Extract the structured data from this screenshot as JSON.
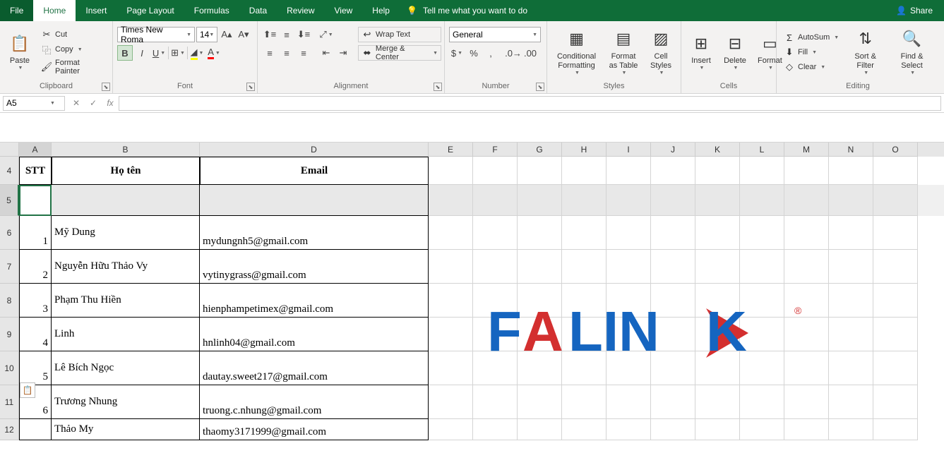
{
  "tabs": {
    "file": "File",
    "home": "Home",
    "insert": "Insert",
    "pageLayout": "Page Layout",
    "formulas": "Formulas",
    "data": "Data",
    "review": "Review",
    "view": "View",
    "help": "Help",
    "tellme": "Tell me what you want to do",
    "share": "Share"
  },
  "ribbon": {
    "clipboard": {
      "label": "Clipboard",
      "paste": "Paste",
      "cut": "Cut",
      "copy": "Copy",
      "formatPainter": "Format Painter"
    },
    "font": {
      "label": "Font",
      "name": "Times New Roma",
      "size": "14"
    },
    "alignment": {
      "label": "Alignment",
      "wrapText": "Wrap Text",
      "mergeCenter": "Merge & Center"
    },
    "number": {
      "label": "Number",
      "format": "General"
    },
    "styles": {
      "label": "Styles",
      "conditional": "Conditional Formatting",
      "formatTable": "Format as Table",
      "cellStyles": "Cell Styles"
    },
    "cells": {
      "label": "Cells",
      "insert": "Insert",
      "delete": "Delete",
      "format": "Format"
    },
    "editing": {
      "label": "Editing",
      "autosum": "AutoSum",
      "fill": "Fill",
      "clear": "Clear",
      "sortFilter": "Sort & Filter",
      "findSelect": "Find & Select"
    }
  },
  "nameBox": "A5",
  "columns": [
    "A",
    "B",
    "D",
    "E",
    "F",
    "G",
    "H",
    "I",
    "J",
    "K",
    "L",
    "M",
    "N",
    "O"
  ],
  "headers": {
    "stt": "STT",
    "hoten": "Họ tên",
    "email": "Email"
  },
  "table": [
    {
      "stt": "1",
      "name": "Mỹ Dung",
      "email": "mydungnh5@gmail.com"
    },
    {
      "stt": "2",
      "name": "Nguyễn Hữu Thảo Vy",
      "email": "vytinygrass@gmail.com"
    },
    {
      "stt": "3",
      "name": "Phạm Thu Hiền",
      "email": "hienphampetimex@gmail.com"
    },
    {
      "stt": "4",
      "name": "Linh",
      "email": "hnlinh04@gmail.com"
    },
    {
      "stt": "5",
      "name": "Lê Bích Ngọc",
      "email": "dautay.sweet217@gmail.com"
    },
    {
      "stt": "6",
      "name": "Trương Nhung",
      "email": "truong.c.nhung@gmail.com"
    },
    {
      "stt": "",
      "name": "Thảo My",
      "email": "thaomy3171999@gmail.com"
    }
  ],
  "logo": {
    "text": "FALINK",
    "trademark": "®"
  }
}
